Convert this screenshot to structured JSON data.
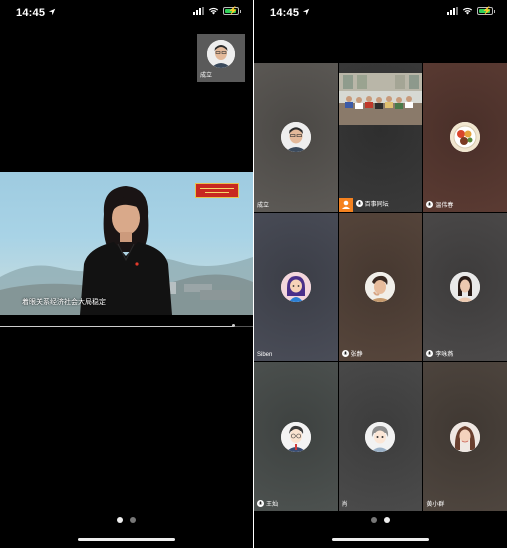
{
  "status_bar": {
    "time": "14:45"
  },
  "left_screen": {
    "self_view": {
      "name": "成立"
    },
    "shared_video": {
      "subtitle": "着眼关系经济社会大局稳定",
      "playback_fraction": 0.92
    },
    "page_indicator": {
      "count": 2,
      "active": 0
    }
  },
  "right_screen": {
    "participants": [
      {
        "name": "成立",
        "tile_color": "#5d5a56",
        "avatar": "man-glasses",
        "badge": ""
      },
      {
        "name": "百事同坛",
        "tile_color": "#3a3a3a",
        "avatar": "group-photo",
        "badge": "orange-person"
      },
      {
        "name": "温伟春",
        "tile_color": "#5b3b33",
        "avatar": "food-plate",
        "badge": "mic"
      },
      {
        "name": "Siben",
        "tile_color": "#4a4d58",
        "avatar": "cartoon-girl",
        "badge": ""
      },
      {
        "name": "张静",
        "tile_color": "#57463c",
        "avatar": "woman-cheek",
        "badge": "mic"
      },
      {
        "name": "李咏燕",
        "tile_color": "#4c4a4a",
        "avatar": "woman-portrait",
        "badge": "mic"
      },
      {
        "name": "王灿",
        "tile_color": "#4d5250",
        "avatar": "cartoon-man-glasses",
        "badge": "mic"
      },
      {
        "name": "肖",
        "tile_color": "#4b4b4b",
        "avatar": "cartoon-gray-hair",
        "badge": ""
      },
      {
        "name": "黄小群",
        "tile_color": "#4f463f",
        "avatar": "woman-long-hair",
        "badge": ""
      }
    ],
    "page_indicator": {
      "count": 2,
      "active": 1
    }
  }
}
